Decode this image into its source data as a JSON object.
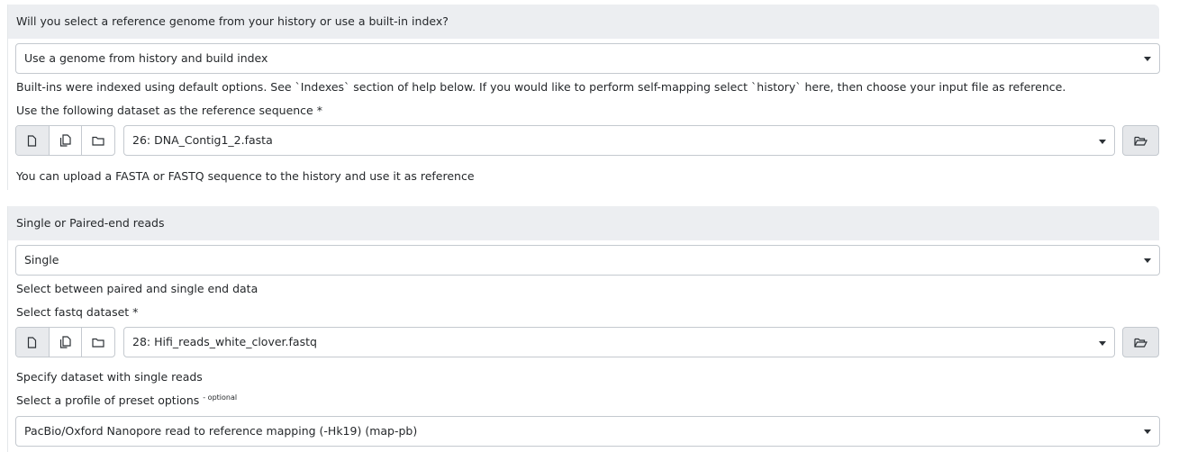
{
  "section1": {
    "title": "Will you select a reference genome from your history or use a built-in index?",
    "select_value": "Use a genome from history and build index",
    "help": "Built-ins were indexed using default options. See `Indexes` section of help below. If you would like to perform self-mapping select `history` here, then choose your input file as reference.",
    "ref_label": "Use the following dataset as the reference sequence",
    "required_mark": "*",
    "ref_value": "26: DNA_Contig1_2.fasta",
    "ref_help": "You can upload a FASTA or FASTQ sequence to the history and use it as reference"
  },
  "section2": {
    "title": "Single or Paired-end reads",
    "select_value": "Single",
    "help": "Select between paired and single end data",
    "fastq_label": "Select fastq dataset",
    "required_mark": "*",
    "fastq_value": "28: Hifi_reads_white_clover.fastq",
    "fastq_help": "Specify dataset with single reads",
    "preset_label": "Select a profile of preset options",
    "optional_tag": "- optional",
    "preset_value": "PacBio/Oxford Nanopore read to reference mapping (-Hk19) (map-pb)"
  },
  "icons": [
    "single-dataset-icon",
    "multiple-datasets-icon",
    "collection-folder-icon",
    "browse-folder-open-icon",
    "dropdown-caret-icon"
  ]
}
